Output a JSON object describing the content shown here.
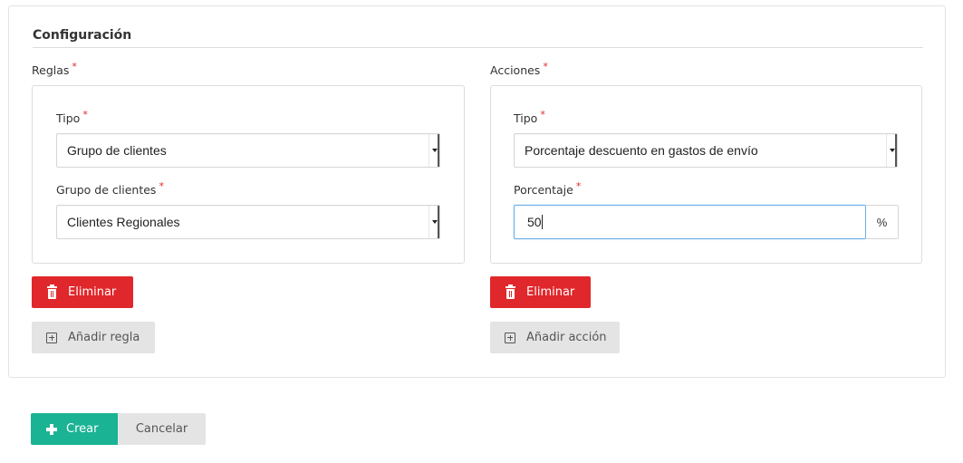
{
  "section": {
    "title": "Configuración"
  },
  "rules": {
    "label": "Reglas",
    "required_mark": "*",
    "type_label": "Tipo",
    "type_value": "Grupo de clientes",
    "group_label": "Grupo de clientes",
    "group_value": "Clientes Regionales",
    "delete_label": "Eliminar",
    "add_label": "Añadir regla"
  },
  "actions": {
    "label": "Acciones",
    "required_mark": "*",
    "type_label": "Tipo",
    "type_value": "Porcentaje descuento en gastos de envío",
    "percent_label": "Porcentaje",
    "percent_value": "50",
    "percent_addon": "%",
    "delete_label": "Eliminar",
    "add_label": "Añadir acción"
  },
  "footer": {
    "create_label": "Crear",
    "cancel_label": "Cancelar"
  },
  "colors": {
    "danger": "#e0272b",
    "success": "#1ab394",
    "required": "#e02a2a",
    "focus_border": "#66afe9"
  },
  "icons": {
    "delete": "trash-icon",
    "add": "plus-square-icon",
    "create": "plus-icon",
    "select": "chevron-down-icon"
  }
}
